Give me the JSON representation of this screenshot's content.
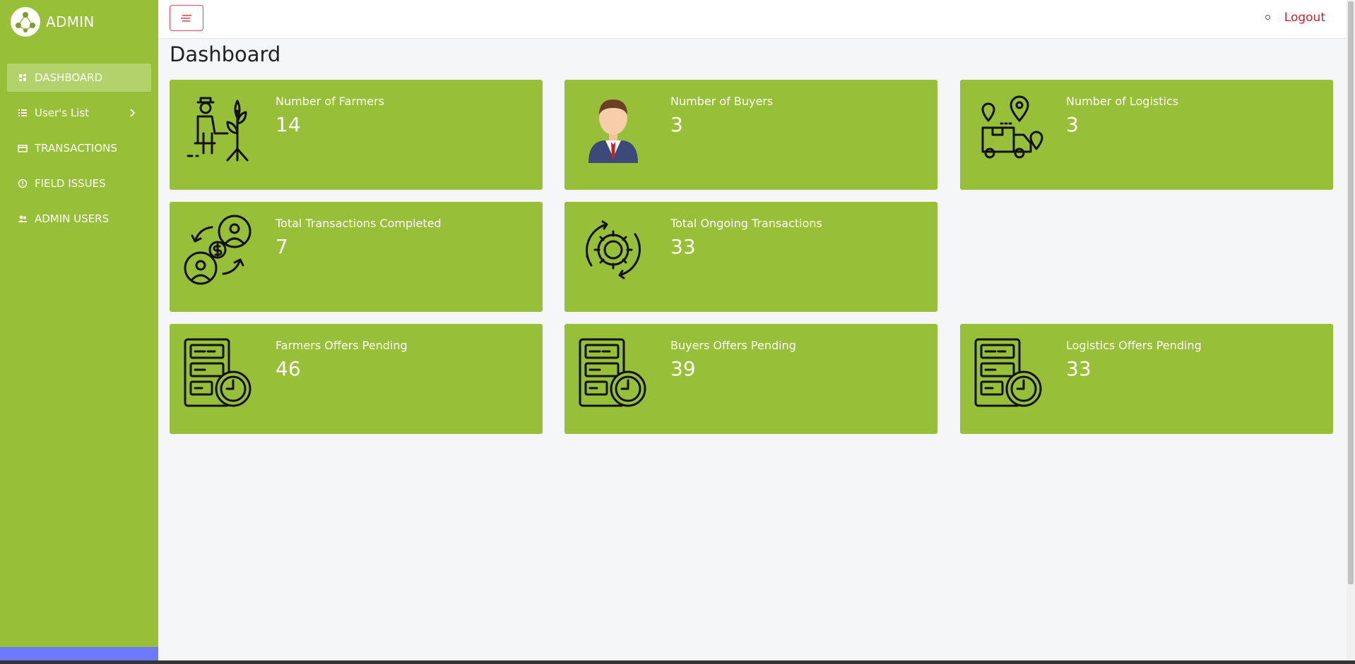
{
  "brand": {
    "title": "ADMIN"
  },
  "sidebar": {
    "items": [
      {
        "label": "DASHBOARD",
        "icon": "dashboard-icon",
        "active": true
      },
      {
        "label": "User's List",
        "icon": "list-icon",
        "has_submenu": true
      },
      {
        "label": "TRANSACTIONS",
        "icon": "card-icon"
      },
      {
        "label": "FIELD ISSUES",
        "icon": "alert-circle-icon"
      },
      {
        "label": "ADMIN USERS",
        "icon": "users-icon"
      }
    ]
  },
  "header": {
    "logout_label": "Logout"
  },
  "page": {
    "title": "Dashboard"
  },
  "cards": [
    {
      "label": "Number of Farmers",
      "value": "14",
      "icon": "farmer-icon"
    },
    {
      "label": "Number of Buyers",
      "value": "3",
      "icon": "buyer-avatar-icon"
    },
    {
      "label": "Number of Logistics",
      "value": "3",
      "icon": "logistics-truck-icon"
    },
    {
      "label": "Total Transactions Completed",
      "value": "7",
      "icon": "money-exchange-icon"
    },
    {
      "label": "Total Ongoing Transactions",
      "value": "33",
      "icon": "gear-cycle-icon"
    },
    {
      "label": "Farmers Offers Pending",
      "value": "46",
      "icon": "pending-document-icon"
    },
    {
      "label": "Buyers Offers Pending",
      "value": "39",
      "icon": "pending-document-icon"
    },
    {
      "label": "Logistics Offers Pending",
      "value": "33",
      "icon": "pending-document-icon"
    }
  ],
  "colors": {
    "sidebar": "#97bf37",
    "card": "#97bf37",
    "active_item": "#b2d26c",
    "logout": "#d0242d",
    "sidebar_footer": "#6b78ff"
  }
}
